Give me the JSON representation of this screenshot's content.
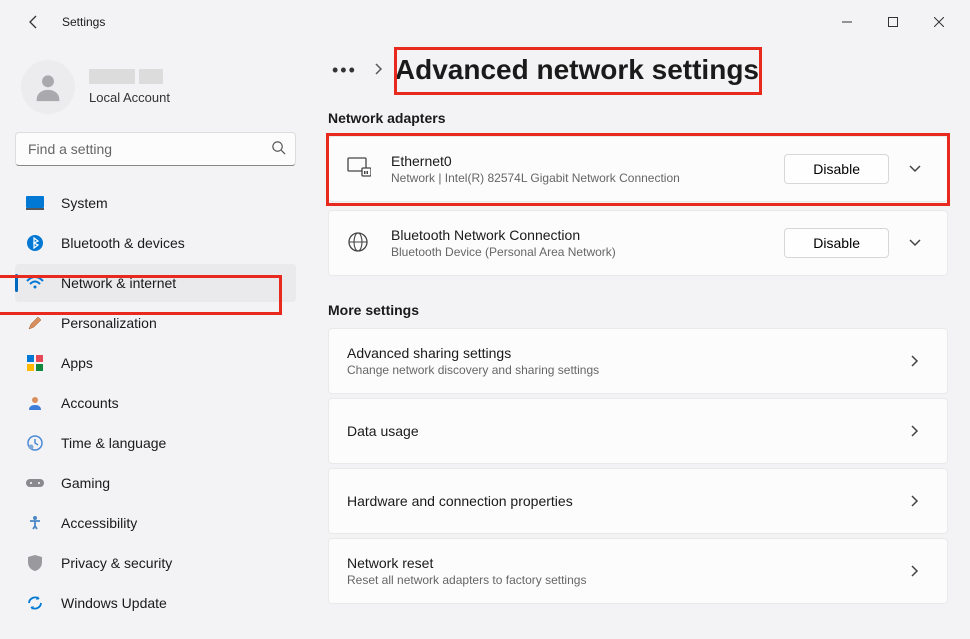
{
  "titlebar": {
    "title": "Settings"
  },
  "user": {
    "account_type": "Local Account"
  },
  "search": {
    "placeholder": "Find a setting"
  },
  "sidebar": {
    "items": [
      {
        "label": "System"
      },
      {
        "label": "Bluetooth & devices"
      },
      {
        "label": "Network & internet"
      },
      {
        "label": "Personalization"
      },
      {
        "label": "Apps"
      },
      {
        "label": "Accounts"
      },
      {
        "label": "Time & language"
      },
      {
        "label": "Gaming"
      },
      {
        "label": "Accessibility"
      },
      {
        "label": "Privacy & security"
      },
      {
        "label": "Windows Update"
      }
    ]
  },
  "page": {
    "title": "Advanced network settings"
  },
  "sections": {
    "adapters_label": "Network adapters",
    "more_label": "More settings"
  },
  "adapters": [
    {
      "name": "Ethernet0",
      "desc": "Network | Intel(R) 82574L Gigabit Network Connection",
      "action": "Disable"
    },
    {
      "name": "Bluetooth Network Connection",
      "desc": "Bluetooth Device (Personal Area Network)",
      "action": "Disable"
    }
  ],
  "more": [
    {
      "title": "Advanced sharing settings",
      "sub": "Change network discovery and sharing settings"
    },
    {
      "title": "Data usage",
      "sub": ""
    },
    {
      "title": "Hardware and connection properties",
      "sub": ""
    },
    {
      "title": "Network reset",
      "sub": "Reset all network adapters to factory settings"
    }
  ]
}
